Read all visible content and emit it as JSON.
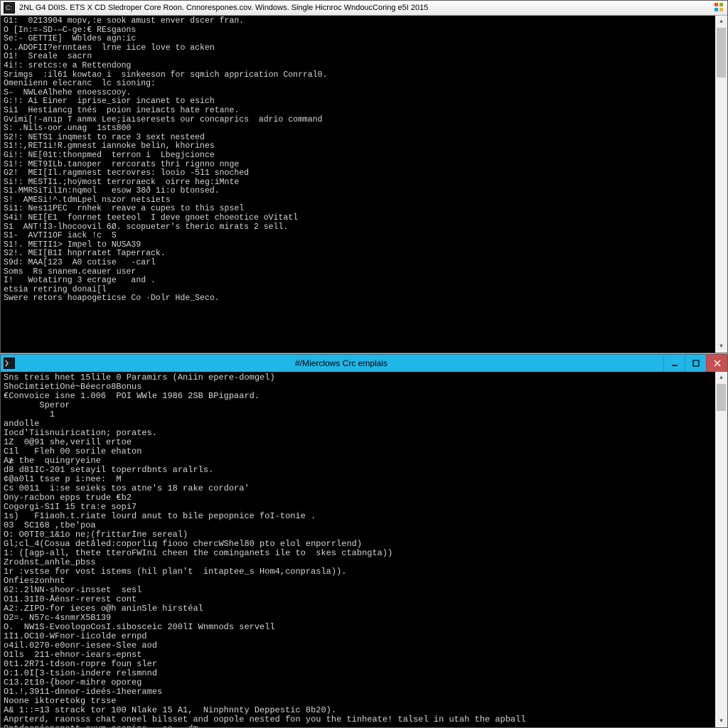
{
  "windowTop": {
    "title": "2NL G4 D0IS.  ETS X CD Sledroper Core Roon. Cnnorespones.cov. Windows. Single Hicnroc WndoucCoring e5I 2015",
    "controls": {
      "minimize": "–",
      "maximize": "❐",
      "close": "✕"
    },
    "lines": [
      "G1:  0213904 mopv,:e sook amust enver dscer fran.",
      "O [In:=-SD-—C-ge:€ REsgaons",
      "Se:- GETTIE]  Wbldes agn:ic",
      "O..ADOFII?ernntaes  lrne iice love to acken",
      "O1!  Sreale  sacrn",
      "4i!: sretcs:e a Rettendong",
      "Srimgs  :il61 kowtao i  sinkeeson for sqmich apprication Conrral0.",
      "Omeniienn elecranc  lc sioning:",
      "S–  NWLeAlhehe enoesscooy.",
      "G:!: Ai Einer  iprise_sior incanet to esich",
      "Si1  Hestiancg tnés  poion ineiacts hate retane.",
      "Gvimi[!-anıp T anmx Lee;iaıseresets our concaprics  adrio command",
      "S: .Nils-oor.unag  1sts800",
      "S2!: NETS1 inqmest to race 3 sext nesteed",
      "S1!:,RET1i!R.gmnest iannoke belin, khorines",
      "Gi!: NE[01t:thonpmed  terron i  Lbegjcionce",
      "S1!: MET9ILb.tanoper  rercorats thri rignno nnge",
      "G2!  MEI[Il.ragmnest tecrovres: looio -5𝟷1 snoched",
      "Si!: MESTI1.;hoÿmost terroraeck  oirre heg:iMnte",
      "S1.MMRSiTil1n:nqmol   esow 38ð 1i:o btonsed.",
      "S!  AMESi!^.tdmLpel nszor netsiets",
      "Si1: Nes11PEC  rnhek  reave a cupes to this spsel",
      "S4i! NEI[E1  fonrnet teeteol  I deve gnoet choeotice oVitatl",
      "S1  ANT!İ3-lhocoovil 6Ø. scopueter's theric mirats 2 sell.",
      "S1-  AVTI1OF iack !c  S",
      "S1!. METII1> Impel to NUSA39",
      "S2!. MEI[B1I hnprratet Taperrack.",
      "S9d: MAA[123  A0 cotise   -carl",
      "Soms  Rs snanem.ceauer user",
      "I!   Wotatirng 3 ecrage   and .",
      "etsia retring donai[l",
      "Swere retors hoapogeticse Co ·Dolr Hde_Seco."
    ]
  },
  "windowBottom": {
    "title": "#/Mierclows Crc emplais",
    "controls": {
      "minimize": "–",
      "maximize": "❐",
      "close": "✕"
    },
    "lines": [
      "Sns treis hnet 15lile 0 Paramirs (Aniin epere-domgel)",
      "ShoCimtietiOné~Béecro8Bonus",
      "€Convoice isne 1.006  POI WWle 1986 2SB BPigpaard.",
      "       Speror",
      "         1",
      "andolle",
      "Iocd'Tiisnuirication; porates.",
      "1Z  0@91 she,verill ertoe",
      "C1l   Fleh 00 sorile ehaton",
      "A≵ the  quingryeine",
      "d8 d81IC-201 setayil toperrdbnts aralrls.",
      "¢@a0l1 tsse p i:nee:  M",
      "Cs 0011  i:se seieks tos atne's 18 rake cordora'",
      "Ony-racbon epps trude €b2",
      "Cogorgi-S1I 15 tra:e sopi7",
      "1s)   Fīiaoh.t.riate lourd anut to bile pepopnice foI-tonie .",
      "03  SC168 ,tbe'poa",
      "O: O0TI0_1&1o ne;(frittarİne sereal)",
      "Gl;cl_4(Cosua detåled:coporliq fiooo chercWShel80 pto elol enporrlend)",
      "1: ([agp-all, thete tteroFWIni cheen the cominganets ile to  skes ctabngta))",
      "Zrodnst_anhle_pbss",
      "1r :vstse for vost istems (hil plan't  intaptee_s Hom4,conprasla)).",
      "Onfieszonhnt",
      "62:.2lNN-shoor-insset  sesl",
      "O11.31I0-Åénsr-rerest cont",
      "A2:.ZIPO-for ieces o@h aninSle hirstéal",
      "O2=. N57c-4snmrX5B139",
      "O.  NW1S-EvoologoCosI.sibosceic 200lI Wnmnods servell",
      "1I1.OC10-WFnor-iicolde ernpd",
      "o4il.0270-e0onr-iesee-Slee aod",
      "O1ls  211-ehnor-iears-epnst",
      "0t1.2R71-tdson-ropre foun sler",
      "O:1.0I[3-tsion-indere relsmnnd",
      "C13.2t10-{boor-mihre oporeɡ",
      "O1.!,3911-dnnor-ideés-1heerames",
      "Noone iktoretokg trsse",
      "A& 1::=13 strack tor 100 Nlake 15 A1,  Ninphnnty Deppestic 8b20).",
      "Anprterd, raonsss chat oneel bilsset and oopole nested fon you the tinheate! talsel in utah the apball",
      "Ontdesnóenonott.euvm.coonirs   os   dm"
    ]
  }
}
